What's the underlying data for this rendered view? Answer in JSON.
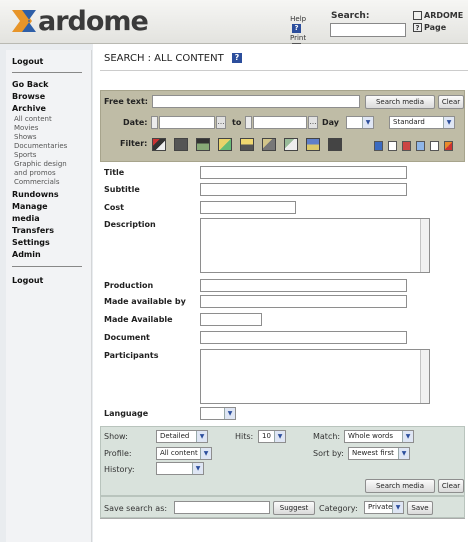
{
  "header": {
    "logo_text": "ardome",
    "help_label": "Help",
    "print_label": "Print",
    "search_label": "Search:",
    "search_value": "",
    "ardome_label": "ARDOME",
    "page_label": "Page"
  },
  "sidebar": {
    "logout_top": "Logout",
    "go_back": "Go Back",
    "browse": "Browse",
    "archive": "Archive",
    "archive_items": [
      "All content",
      "Movies",
      "Shows",
      "Documentaries",
      "Sports",
      "Graphic design",
      "and promos",
      "Commercials"
    ],
    "rundowns": "Rundowns",
    "manage": "Manage",
    "media": "media",
    "transfers": "Transfers",
    "settings": "Settings",
    "admin": "Admin",
    "logout_bottom": "Logout"
  },
  "page": {
    "title": "SEARCH : ALL CONTENT"
  },
  "search": {
    "free_text_label": "Free text:",
    "free_text_value": "",
    "search_button": "Search media",
    "clear_button": "Clear",
    "date_label": "Date:",
    "to_label": "to",
    "day_label": "Day",
    "day_value": "",
    "mode_value": "Standard",
    "filter_label": "Filter:"
  },
  "fields": {
    "title": "Title",
    "subtitle": "Subtitle",
    "cost": "Cost",
    "description": "Description",
    "production": "Production",
    "made_available_by": "Made available by",
    "made_available": "Made Available",
    "document": "Document",
    "participants": "Participants",
    "language": "Language",
    "language_value": ""
  },
  "options": {
    "show_label": "Show:",
    "show_value": "Detailed",
    "hits_label": "Hits:",
    "hits_value": "10",
    "match_label": "Match:",
    "match_value": "Whole words",
    "profile_label": "Profile:",
    "profile_value": "All content",
    "sort_label": "Sort by:",
    "sort_value": "Newest first",
    "history_label": "History:",
    "history_value": "",
    "search_button": "Search media",
    "clear_button": "Clear"
  },
  "save": {
    "label": "Save search as:",
    "value": "",
    "suggest_button": "Suggest",
    "category_label": "Category:",
    "category_value": "Private",
    "save_button": "Save"
  },
  "colors": {
    "search_panel": "#bfbca6",
    "options_panel": "#d9e2dc",
    "accent_blue": "#2c4e9c"
  }
}
